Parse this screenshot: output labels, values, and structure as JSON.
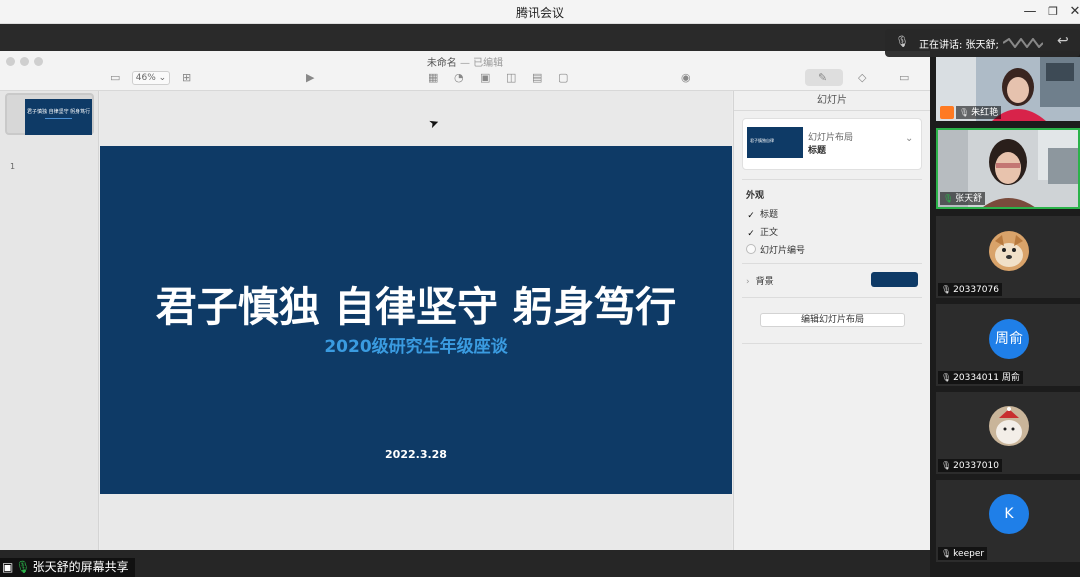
{
  "window": {
    "title": "腾讯会议",
    "controls": [
      "—",
      "❐",
      "✕"
    ]
  },
  "keynote": {
    "doc_title": "未命名",
    "doc_status": "— 已编辑",
    "zoom": "46%",
    "slide_number": "1",
    "slide": {
      "title": "君子慎独 自律坚守 躬身笃行",
      "subtitle": "2020级研究生年级座谈",
      "date": "2022.3.28",
      "thumb_title": "君子慎独 自律坚守 躬身笃行"
    },
    "inspector": {
      "header": "幻灯片",
      "layout_label": "幻灯片布局",
      "layout_value": "标题",
      "layout_thumb_title": "君子慎独自律",
      "appearance_label": "外观",
      "options": [
        {
          "label": "标题",
          "checked": true
        },
        {
          "label": "正文",
          "checked": true
        },
        {
          "label": "幻灯片编号",
          "checked": false
        }
      ],
      "background_label": "背景",
      "edit_layout_button": "编辑幻灯片布局"
    }
  },
  "speaker": {
    "text": "正在讲话: 张天舒;"
  },
  "participants": [
    {
      "name": "朱红艳",
      "type": "video",
      "host": true
    },
    {
      "name": "张天舒",
      "type": "video",
      "active": true
    },
    {
      "name": "20337076",
      "type": "photo"
    },
    {
      "name": "20334011 周俞",
      "type": "initials",
      "initials": "周俞"
    },
    {
      "name": "20337010",
      "type": "photo"
    },
    {
      "name": "keeper",
      "type": "initials",
      "initials": "K"
    }
  ],
  "screen_share_label": "张天舒的屏幕共享",
  "colors": {
    "slide_bg": "#0e3a66",
    "subtitle": "#3a9be0",
    "avatar_blue": "#1f7fe8",
    "active_green": "#2bb34a"
  }
}
